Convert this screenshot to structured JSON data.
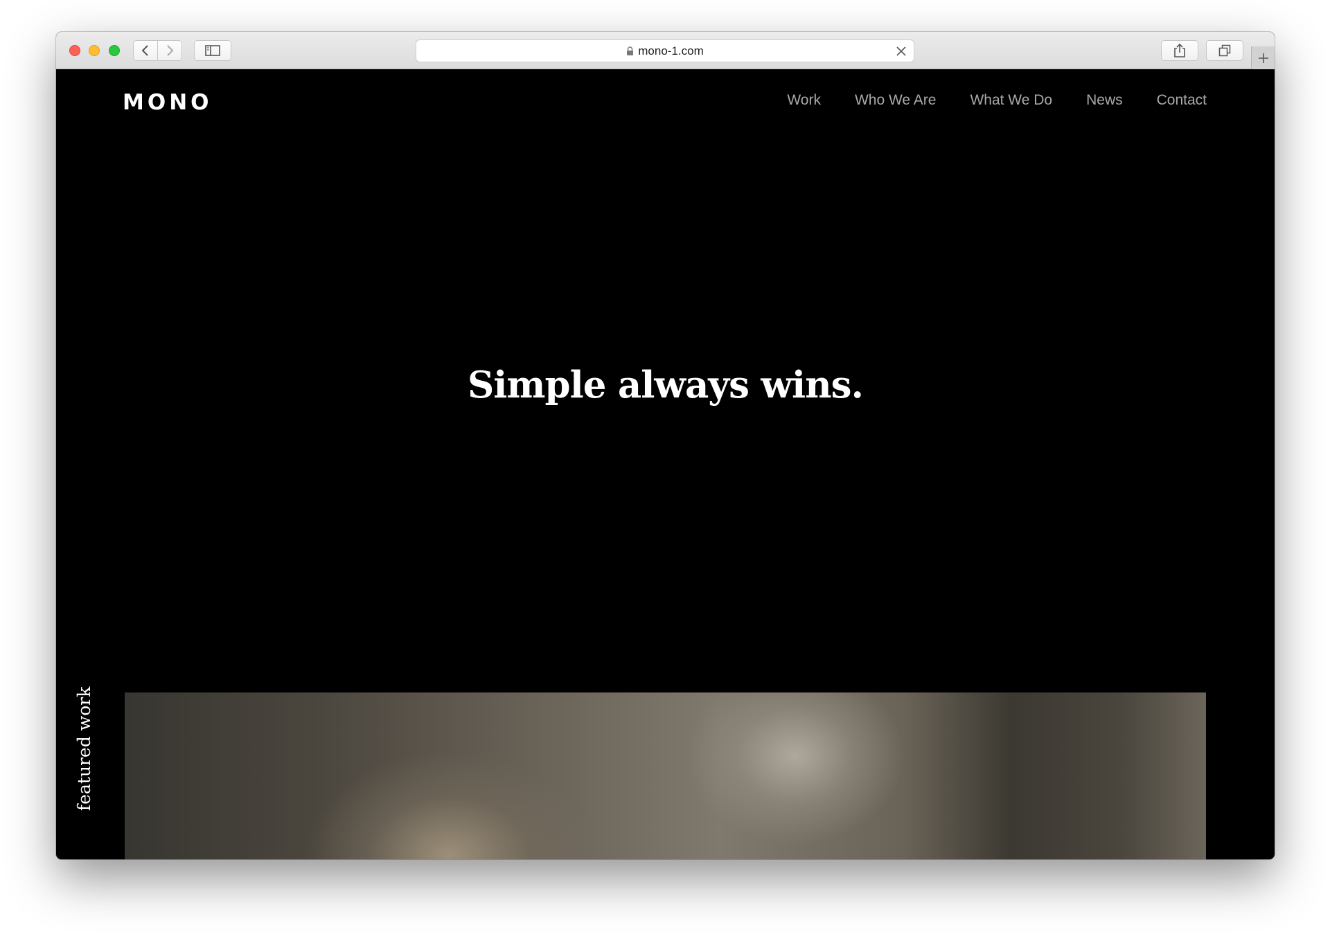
{
  "browser": {
    "url": "mono-1.com"
  },
  "site": {
    "logo": "MONO",
    "nav": [
      {
        "label": "Work"
      },
      {
        "label": "Who We Are"
      },
      {
        "label": "What We Do"
      },
      {
        "label": "News"
      },
      {
        "label": "Contact"
      }
    ],
    "hero_title": "Simple always wins.",
    "featured_label": "featured work"
  },
  "colors": {
    "page_background": "#000000",
    "nav_text": "#a9a9a9",
    "hero_text": "#ffffff"
  }
}
